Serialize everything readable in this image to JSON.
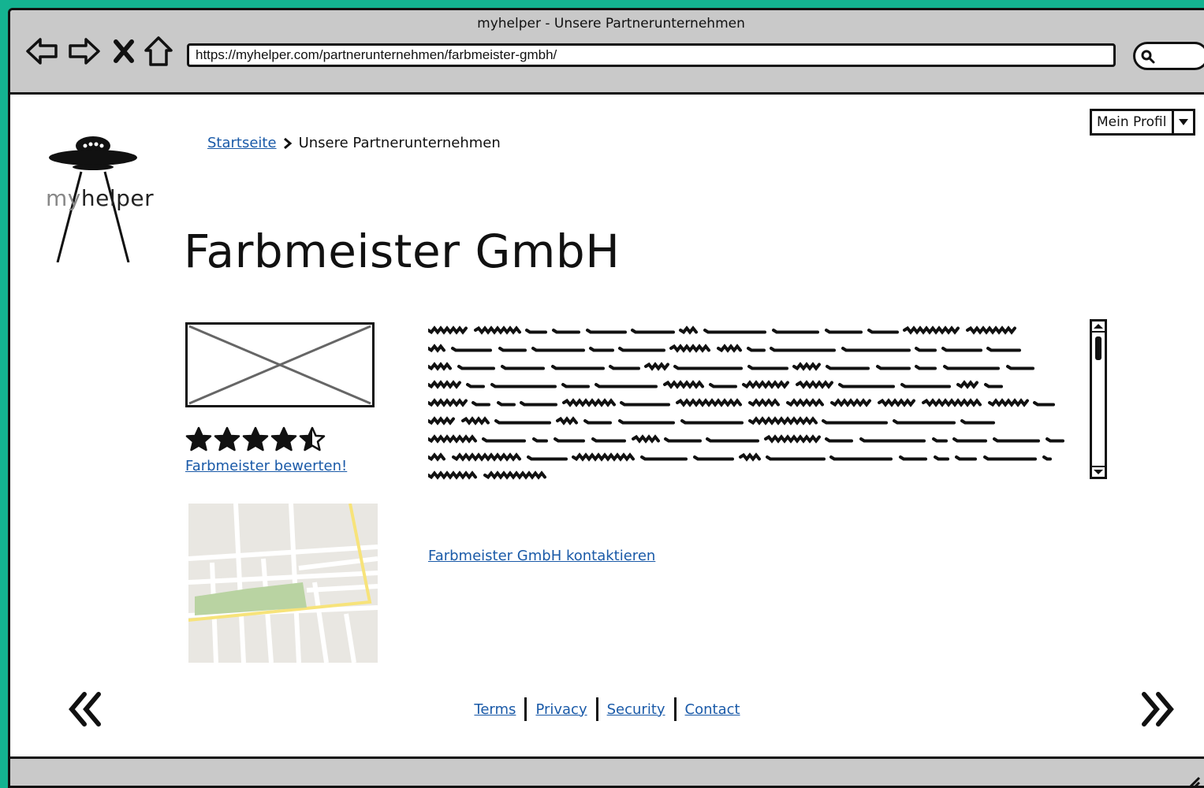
{
  "window": {
    "title": "myhelper - Unsere Partnerunternehmen"
  },
  "toolbar": {
    "url": "https://myhelper.com/partnerunternehmen/farbmeister-gmbh/",
    "buttons": [
      "back-icon",
      "forward-icon",
      "stop-icon",
      "home-icon"
    ]
  },
  "logo": {
    "prefix": "my",
    "suffix": "helper"
  },
  "breadcrumb": {
    "home": "Startseite",
    "current": "Unsere Partnerunternehmen"
  },
  "profile": {
    "label": "Mein Profil"
  },
  "company": {
    "name": "Farbmeister GmbH",
    "rating": 4.5,
    "rating_max": 5,
    "rate_link": "Farbmeister bewerten!",
    "contact_link": "Farbmeister GmbH kontaktieren"
  },
  "footer": {
    "links": [
      "Terms",
      "Privacy",
      "Security",
      "Contact"
    ]
  }
}
